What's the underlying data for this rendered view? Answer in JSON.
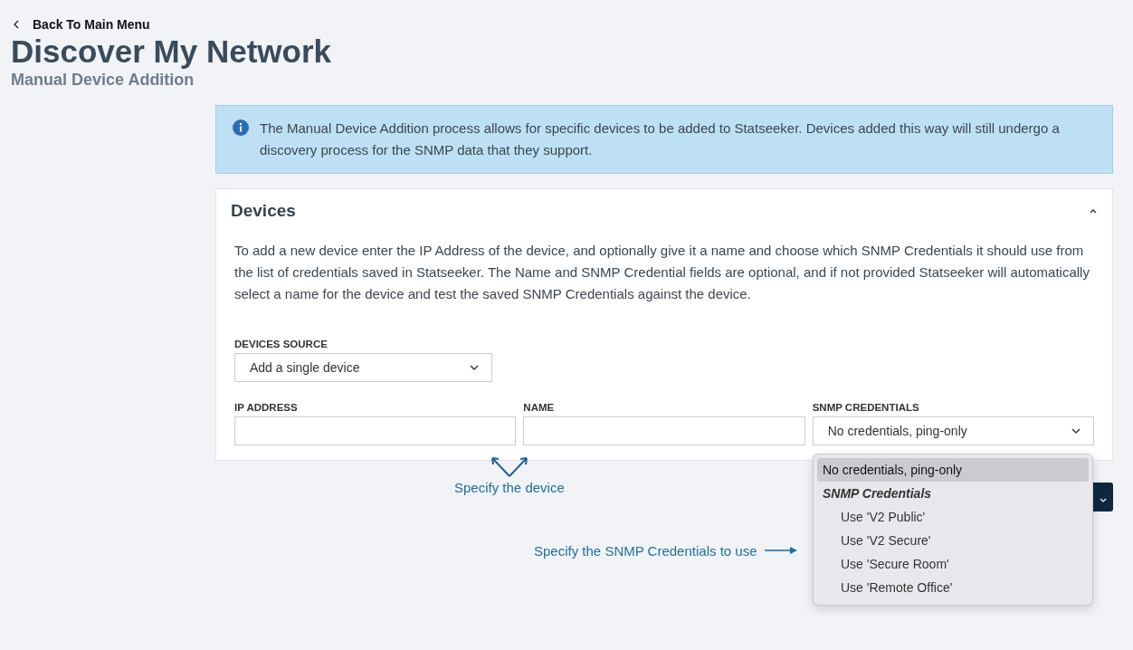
{
  "back_link": "Back To Main Menu",
  "title": "Discover My Network",
  "subtitle": "Manual Device Addition",
  "info": "The Manual Device Addition process allows for specific devices to be added to Statseeker. Devices added this way will still undergo a discovery process for the SNMP data that they support.",
  "panel": {
    "title": "Devices",
    "expanded": true,
    "description": "To add a new device enter the IP Address of the device, and optionally give it a name and choose which SNMP Credentials it should use from the list of credentials saved in Statseeker. The Name and SNMP Credential fields are optional, and if not provided Statseeker will automatically select a name for the device and test the saved SNMP Credentials against the device.",
    "source": {
      "label": "DEVICES SOURCE",
      "value": "Add a single device"
    },
    "fields": [
      {
        "kind": "text",
        "label": "IP ADDRESS"
      },
      {
        "kind": "text",
        "label": "NAME"
      },
      {
        "kind": "select",
        "label": "SNMP CREDENTIALS",
        "value": "No credentials, ping-only"
      }
    ]
  },
  "dropdown": {
    "open": true,
    "options": [
      {
        "kind": "option",
        "label": "No credentials, ping-only",
        "selected": true
      },
      {
        "kind": "group",
        "label": "SNMP Credentials"
      },
      {
        "kind": "option",
        "label": "Use 'V2 Public'",
        "selected": false
      },
      {
        "kind": "option",
        "label": "Use 'V2 Secure'",
        "selected": false
      },
      {
        "kind": "option",
        "label": "Use 'Secure Room'",
        "selected": false
      },
      {
        "kind": "option",
        "label": "Use 'Remote Office'",
        "selected": false
      }
    ]
  },
  "annotations": [
    {
      "kind": "up",
      "text": "Specify the device"
    },
    {
      "kind": "right",
      "text": "Specify the SNMP Credentials to use"
    }
  ]
}
